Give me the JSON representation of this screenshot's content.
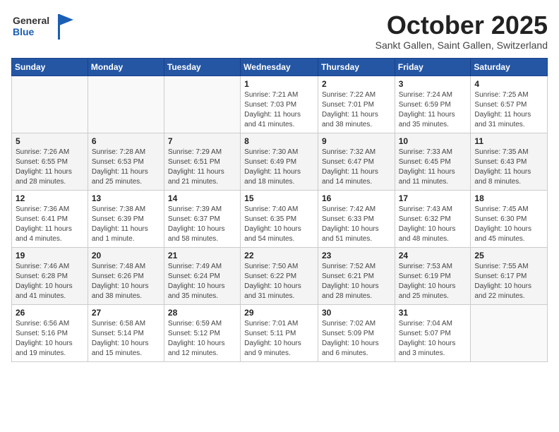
{
  "header": {
    "logo_line1": "General",
    "logo_line2": "Blue",
    "month": "October 2025",
    "location": "Sankt Gallen, Saint Gallen, Switzerland"
  },
  "weekdays": [
    "Sunday",
    "Monday",
    "Tuesday",
    "Wednesday",
    "Thursday",
    "Friday",
    "Saturday"
  ],
  "weeks": [
    [
      {
        "day": "",
        "info": ""
      },
      {
        "day": "",
        "info": ""
      },
      {
        "day": "",
        "info": ""
      },
      {
        "day": "1",
        "info": "Sunrise: 7:21 AM\nSunset: 7:03 PM\nDaylight: 11 hours\nand 41 minutes."
      },
      {
        "day": "2",
        "info": "Sunrise: 7:22 AM\nSunset: 7:01 PM\nDaylight: 11 hours\nand 38 minutes."
      },
      {
        "day": "3",
        "info": "Sunrise: 7:24 AM\nSunset: 6:59 PM\nDaylight: 11 hours\nand 35 minutes."
      },
      {
        "day": "4",
        "info": "Sunrise: 7:25 AM\nSunset: 6:57 PM\nDaylight: 11 hours\nand 31 minutes."
      }
    ],
    [
      {
        "day": "5",
        "info": "Sunrise: 7:26 AM\nSunset: 6:55 PM\nDaylight: 11 hours\nand 28 minutes."
      },
      {
        "day": "6",
        "info": "Sunrise: 7:28 AM\nSunset: 6:53 PM\nDaylight: 11 hours\nand 25 minutes."
      },
      {
        "day": "7",
        "info": "Sunrise: 7:29 AM\nSunset: 6:51 PM\nDaylight: 11 hours\nand 21 minutes."
      },
      {
        "day": "8",
        "info": "Sunrise: 7:30 AM\nSunset: 6:49 PM\nDaylight: 11 hours\nand 18 minutes."
      },
      {
        "day": "9",
        "info": "Sunrise: 7:32 AM\nSunset: 6:47 PM\nDaylight: 11 hours\nand 14 minutes."
      },
      {
        "day": "10",
        "info": "Sunrise: 7:33 AM\nSunset: 6:45 PM\nDaylight: 11 hours\nand 11 minutes."
      },
      {
        "day": "11",
        "info": "Sunrise: 7:35 AM\nSunset: 6:43 PM\nDaylight: 11 hours\nand 8 minutes."
      }
    ],
    [
      {
        "day": "12",
        "info": "Sunrise: 7:36 AM\nSunset: 6:41 PM\nDaylight: 11 hours\nand 4 minutes."
      },
      {
        "day": "13",
        "info": "Sunrise: 7:38 AM\nSunset: 6:39 PM\nDaylight: 11 hours\nand 1 minute."
      },
      {
        "day": "14",
        "info": "Sunrise: 7:39 AM\nSunset: 6:37 PM\nDaylight: 10 hours\nand 58 minutes."
      },
      {
        "day": "15",
        "info": "Sunrise: 7:40 AM\nSunset: 6:35 PM\nDaylight: 10 hours\nand 54 minutes."
      },
      {
        "day": "16",
        "info": "Sunrise: 7:42 AM\nSunset: 6:33 PM\nDaylight: 10 hours\nand 51 minutes."
      },
      {
        "day": "17",
        "info": "Sunrise: 7:43 AM\nSunset: 6:32 PM\nDaylight: 10 hours\nand 48 minutes."
      },
      {
        "day": "18",
        "info": "Sunrise: 7:45 AM\nSunset: 6:30 PM\nDaylight: 10 hours\nand 45 minutes."
      }
    ],
    [
      {
        "day": "19",
        "info": "Sunrise: 7:46 AM\nSunset: 6:28 PM\nDaylight: 10 hours\nand 41 minutes."
      },
      {
        "day": "20",
        "info": "Sunrise: 7:48 AM\nSunset: 6:26 PM\nDaylight: 10 hours\nand 38 minutes."
      },
      {
        "day": "21",
        "info": "Sunrise: 7:49 AM\nSunset: 6:24 PM\nDaylight: 10 hours\nand 35 minutes."
      },
      {
        "day": "22",
        "info": "Sunrise: 7:50 AM\nSunset: 6:22 PM\nDaylight: 10 hours\nand 31 minutes."
      },
      {
        "day": "23",
        "info": "Sunrise: 7:52 AM\nSunset: 6:21 PM\nDaylight: 10 hours\nand 28 minutes."
      },
      {
        "day": "24",
        "info": "Sunrise: 7:53 AM\nSunset: 6:19 PM\nDaylight: 10 hours\nand 25 minutes."
      },
      {
        "day": "25",
        "info": "Sunrise: 7:55 AM\nSunset: 6:17 PM\nDaylight: 10 hours\nand 22 minutes."
      }
    ],
    [
      {
        "day": "26",
        "info": "Sunrise: 6:56 AM\nSunset: 5:16 PM\nDaylight: 10 hours\nand 19 minutes."
      },
      {
        "day": "27",
        "info": "Sunrise: 6:58 AM\nSunset: 5:14 PM\nDaylight: 10 hours\nand 15 minutes."
      },
      {
        "day": "28",
        "info": "Sunrise: 6:59 AM\nSunset: 5:12 PM\nDaylight: 10 hours\nand 12 minutes."
      },
      {
        "day": "29",
        "info": "Sunrise: 7:01 AM\nSunset: 5:11 PM\nDaylight: 10 hours\nand 9 minutes."
      },
      {
        "day": "30",
        "info": "Sunrise: 7:02 AM\nSunset: 5:09 PM\nDaylight: 10 hours\nand 6 minutes."
      },
      {
        "day": "31",
        "info": "Sunrise: 7:04 AM\nSunset: 5:07 PM\nDaylight: 10 hours\nand 3 minutes."
      },
      {
        "day": "",
        "info": ""
      }
    ]
  ]
}
